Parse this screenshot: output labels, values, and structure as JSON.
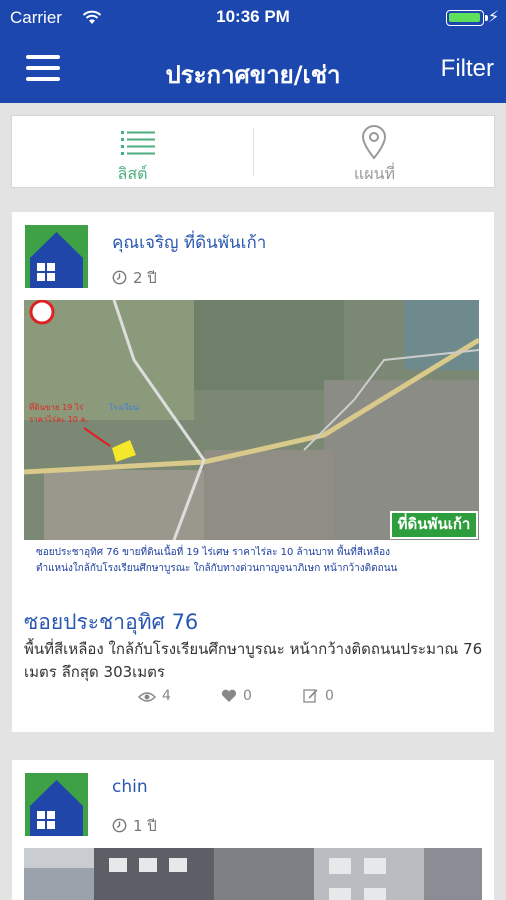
{
  "status_bar": {
    "carrier": "Carrier",
    "time": "10:36 PM",
    "battery_icon": "battery-icon"
  },
  "nav": {
    "title": "ประกาศขาย/เช่า",
    "filter_label": "Filter",
    "menu_icon": "menu-icon"
  },
  "segments": [
    {
      "label": "ลิสต์",
      "icon": "list-icon",
      "selected": true
    },
    {
      "label": "แผนที่",
      "icon": "map-pin-icon",
      "selected": false
    }
  ],
  "listings": [
    {
      "poster": "คุณเจริญ  ที่ดินพันเก้า",
      "age": "2 ปี",
      "image": {
        "caption_line1": "ซอยประชาอุทิศ 76 ขายที่ดินเนื้อที่ 19 ไร่เศษ ราคาไร่ละ 10 ล้านบาท พื้นที่สีเหลือง",
        "caption_line2": "ตำแหน่งใกล้กับโรงเรียนศึกษาบูรณะ ใกล้กับทางด่วนกาญจนาภิเษก หน้ากว้างติดถนน",
        "logo_text": "ที่ดินพันเก้า"
      },
      "title": "ซอยประชาอุทิศ 76",
      "description": "พื้นที่สีเหลือง  ใกล้กับโรงเรียนศึกษาบูรณะ หน้ากว้างติดถนนประมาณ 76 เมตร ลึกสุด 303เมตร",
      "views": "4",
      "likes": "0",
      "comments": "0"
    },
    {
      "poster": "chin",
      "age": "1 ปี"
    }
  ],
  "colors": {
    "header": "#1b47ae",
    "accent_green": "#4caf7d",
    "link_blue": "#2a58b0",
    "avatar_green": "#3ea145"
  }
}
